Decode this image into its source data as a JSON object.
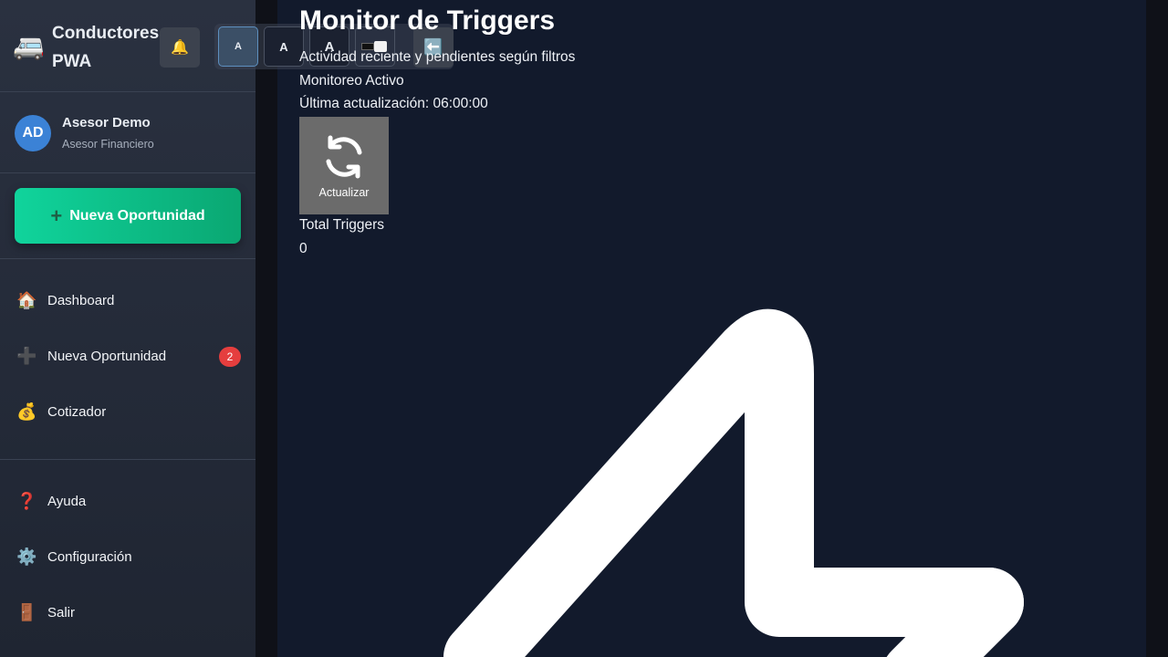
{
  "app": {
    "title": "Conductores PWA",
    "brand_icon": "🚐"
  },
  "user": {
    "initials": "AD",
    "name": "Asesor Demo",
    "role": "Asesor Financiero"
  },
  "cta": {
    "label": "Nueva Oportunidad",
    "icon": "➕"
  },
  "nav": {
    "primary": [
      {
        "icon": "🏠",
        "label": "Dashboard"
      },
      {
        "icon": "➕",
        "label": "Nueva Oportunidad",
        "badge": "2"
      },
      {
        "icon": "💰",
        "label": "Cotizador"
      }
    ],
    "secondary": [
      {
        "icon": "❓",
        "label": "Ayuda"
      },
      {
        "icon": "⚙️",
        "label": "Configuración"
      },
      {
        "icon": "🚪",
        "label": "Salir"
      }
    ]
  },
  "toolbar": {
    "bell_icon": "🔔",
    "font_small": "A",
    "font_medium": "A",
    "font_large": "A",
    "contrast_icon": "◧",
    "back_icon": "⬅️"
  },
  "page": {
    "title": "Monitor de Triggers",
    "subtitle": "Actividad reciente y pendientes según filtros",
    "status": "Monitoreo Activo",
    "last_update": "Última actualización: 06:00:00",
    "refresh_label": "Actualizar",
    "total_label": "Total Triggers",
    "total_value": "0"
  },
  "colors": {
    "sidebar": "#2a3140",
    "main_bg": "#121a2c",
    "accent_green": "#10d49c",
    "badge_red": "#e53e3e",
    "avatar_blue": "#3b82d6"
  }
}
